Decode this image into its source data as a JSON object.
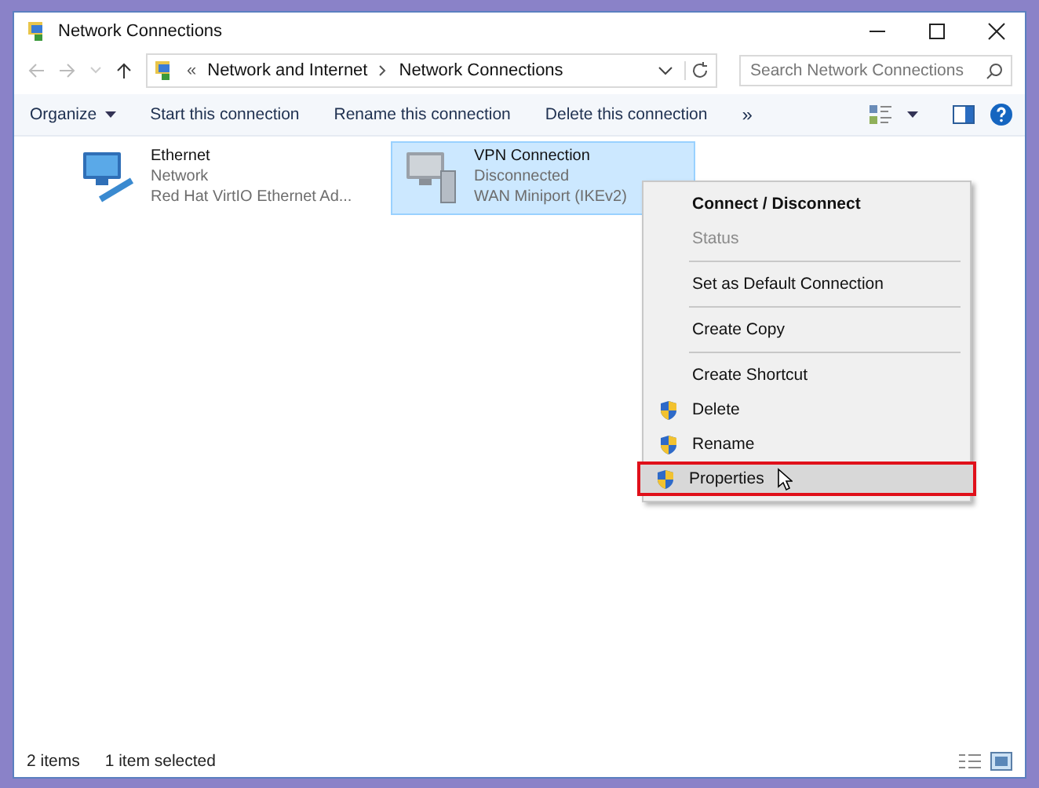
{
  "window": {
    "title": "Network Connections"
  },
  "address_bar": {
    "breadcrumbs": [
      "Network and Internet",
      "Network Connections"
    ],
    "overflow": "«"
  },
  "search": {
    "placeholder": "Search Network Connections"
  },
  "toolbar": {
    "items": [
      {
        "label": "Organize",
        "dropdown": true
      },
      {
        "label": "Start this connection",
        "dropdown": false
      },
      {
        "label": "Rename this connection",
        "dropdown": false
      },
      {
        "label": "Delete this connection",
        "dropdown": false
      }
    ],
    "more": "»"
  },
  "connections": [
    {
      "name": "Ethernet",
      "status": "Network",
      "device": "Red Hat VirtIO Ethernet Ad...",
      "selected": false,
      "disconnected": false
    },
    {
      "name": "VPN Connection",
      "status": "Disconnected",
      "device": "WAN Miniport (IKEv2)",
      "selected": true,
      "disconnected": true
    }
  ],
  "context_menu": {
    "items": [
      {
        "kind": "item",
        "label": "Connect / Disconnect",
        "bold": true,
        "disabled": false,
        "shield": false,
        "selected": false
      },
      {
        "kind": "item",
        "label": "Status",
        "bold": false,
        "disabled": true,
        "shield": false,
        "selected": false
      },
      {
        "kind": "separator"
      },
      {
        "kind": "item",
        "label": "Set as Default Connection",
        "bold": false,
        "disabled": false,
        "shield": false,
        "selected": false
      },
      {
        "kind": "separator"
      },
      {
        "kind": "item",
        "label": "Create Copy",
        "bold": false,
        "disabled": false,
        "shield": false,
        "selected": false
      },
      {
        "kind": "separator"
      },
      {
        "kind": "item",
        "label": "Create Shortcut",
        "bold": false,
        "disabled": false,
        "shield": false,
        "selected": false
      },
      {
        "kind": "item",
        "label": "Delete",
        "bold": false,
        "disabled": false,
        "shield": true,
        "selected": false
      },
      {
        "kind": "item",
        "label": "Rename",
        "bold": false,
        "disabled": false,
        "shield": true,
        "selected": false
      },
      {
        "kind": "item",
        "label": "Properties",
        "bold": false,
        "disabled": false,
        "shield": true,
        "selected": true
      }
    ]
  },
  "status_bar": {
    "item_count": "2 items",
    "selection": "1 item selected"
  }
}
